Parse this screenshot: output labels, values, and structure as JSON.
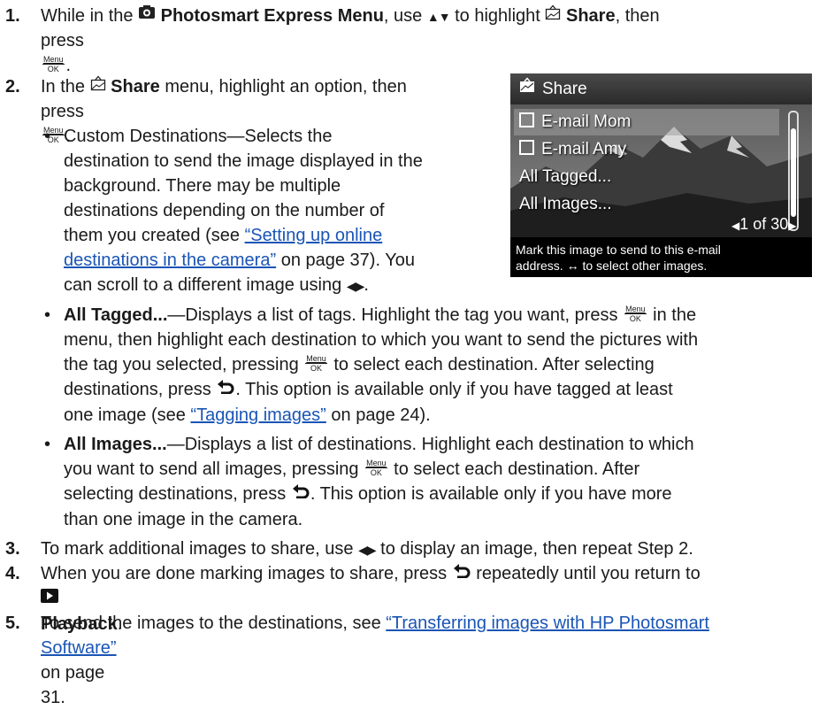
{
  "steps": {
    "s1": {
      "num": "1.",
      "p1": "While in the ",
      "menu_name": "Photosmart Express Menu",
      "p2": ", use ",
      "p3": " to highlight ",
      "share": "Share",
      "p4": ", then",
      "p5": "press ",
      "p6": "."
    },
    "s2": {
      "num": "2.",
      "p1": "In the ",
      "share": "Share",
      "p2": " menu, highlight an option, then",
      "p3": "press ",
      "p4": "."
    },
    "bullets": {
      "custom": {
        "l1": "Custom Destinations—Selects the",
        "l2": "destination to send the image displayed in the",
        "l3": "background. There may be multiple",
        "l4": "destinations depending on the number of",
        "l5a": "them you created (see ",
        "link1": "“Setting up online",
        "link2": "destinations in the camera”",
        "l6b": " on page 37). You",
        "l7": "can scroll to a different image using "
      },
      "tagged": {
        "bold": "All Tagged...",
        "l1": "—Displays a list of tags. Highlight the tag you want, press ",
        "l1b": " in the",
        "l2": "menu, then highlight each destination to which you want to send the pictures with",
        "l3a": "the tag you selected, pressing ",
        "l3b": " to select each destination. After selecting",
        "l4a": "destinations, press ",
        "l4b": ". This option is available only if you have tagged at least",
        "l5a": "one image (see ",
        "link": "“Tagging images”",
        "l5b": " on page 24)."
      },
      "images": {
        "bold": "All Images...",
        "l1": "—Displays a list of destinations. Highlight each destination to which",
        "l2a": "you want to send all images, pressing ",
        "l2b": " to select each destination. After",
        "l3a": "selecting destinations, press ",
        "l3b": ". This option is available only if you have more",
        "l4": "than one image in the camera."
      }
    },
    "s3": {
      "num": "3.",
      "a": "To mark additional images to share, use ",
      "b": " to display an image, then repeat Step 2."
    },
    "s4": {
      "num": "4.",
      "a": "When you are done marking images to share, press ",
      "b": " repeatedly until you return to",
      "playback": "Playback",
      "c": "."
    },
    "s5": {
      "num": "5.",
      "a": "To send the images to the destinations, see ",
      "link1": "“Transferring images with HP Photosmart",
      "link2": "Software”",
      "b": " on page 31."
    }
  },
  "menuok": {
    "top": "Menu",
    "bottom": "OK"
  },
  "screen": {
    "title": "Share",
    "items": [
      "E-mail Mom",
      "E-mail Amy",
      "All Tagged...",
      "All Images..."
    ],
    "counter": "1 of 30",
    "help_l1": "Mark this image to send to this e-mail",
    "help_l2": "address.  ↔ to select other images."
  }
}
